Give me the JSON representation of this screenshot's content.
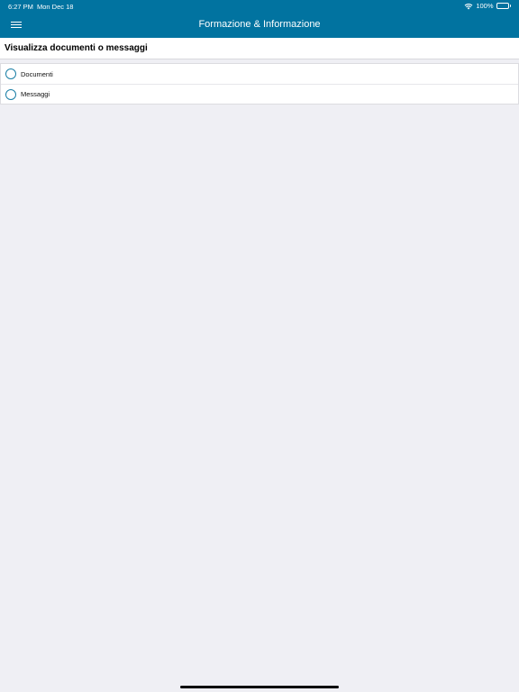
{
  "status_bar": {
    "time": "6:27 PM",
    "date": "Mon Dec 18",
    "battery": "100%",
    "icons": [
      "wifi-icon",
      "battery-icon"
    ]
  },
  "nav": {
    "title": "Formazione & Informazione",
    "menu_icon": "hamburger-menu-icon"
  },
  "section": {
    "title": "Visualizza documenti o messaggi"
  },
  "options": [
    {
      "label": "Documenti",
      "selected": false
    },
    {
      "label": "Messaggi",
      "selected": false
    }
  ],
  "colors": {
    "header_background": "#0173a0",
    "page_background": "#efeff4",
    "radio_accent": "#1b7fa6"
  }
}
